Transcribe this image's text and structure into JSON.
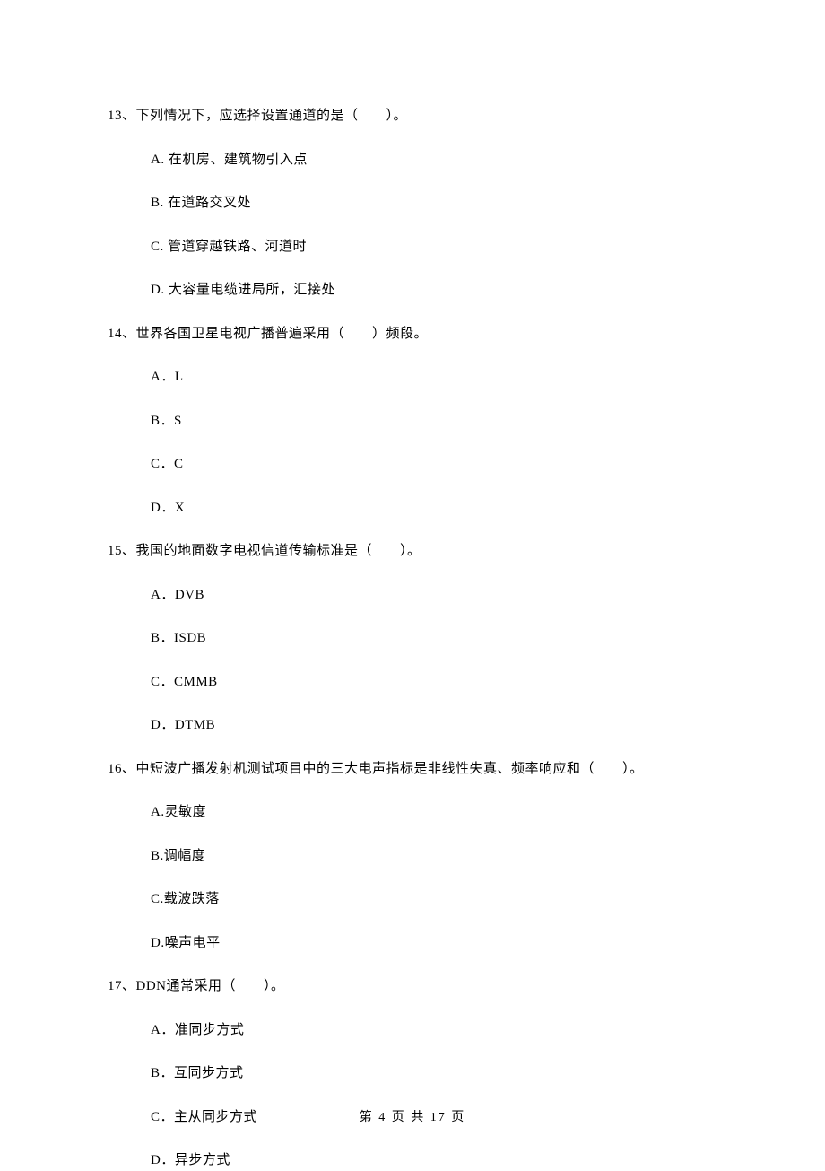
{
  "questions": [
    {
      "number": "13",
      "text": "13、下列情况下，应选择设置通道的是（　　）。",
      "options": [
        "A. 在机房、建筑物引入点",
        "B. 在道路交叉处",
        "C. 管道穿越铁路、河道时",
        "D. 大容量电缆进局所，汇接处"
      ]
    },
    {
      "number": "14",
      "text": "14、世界各国卫星电视广播普遍采用（　　）频段。",
      "options": [
        "A．L",
        "B．S",
        "C．C",
        "D．X"
      ]
    },
    {
      "number": "15",
      "text": "15、我国的地面数字电视信道传输标准是（　　）。",
      "options": [
        "A．DVB",
        "B．ISDB",
        "C．CMMB",
        "D．DTMB"
      ]
    },
    {
      "number": "16",
      "text": "16、中短波广播发射机测试项目中的三大电声指标是非线性失真、频率响应和（　　）。",
      "options": [
        "A.灵敏度",
        "B.调幅度",
        "C.载波跌落",
        "D.噪声电平"
      ]
    },
    {
      "number": "17",
      "text": "17、DDN通常采用（　　）。",
      "options": [
        "A．准同步方式",
        "B．互同步方式",
        "C．主从同步方式",
        "D．异步方式"
      ]
    }
  ],
  "footer": "第 4 页 共 17 页"
}
